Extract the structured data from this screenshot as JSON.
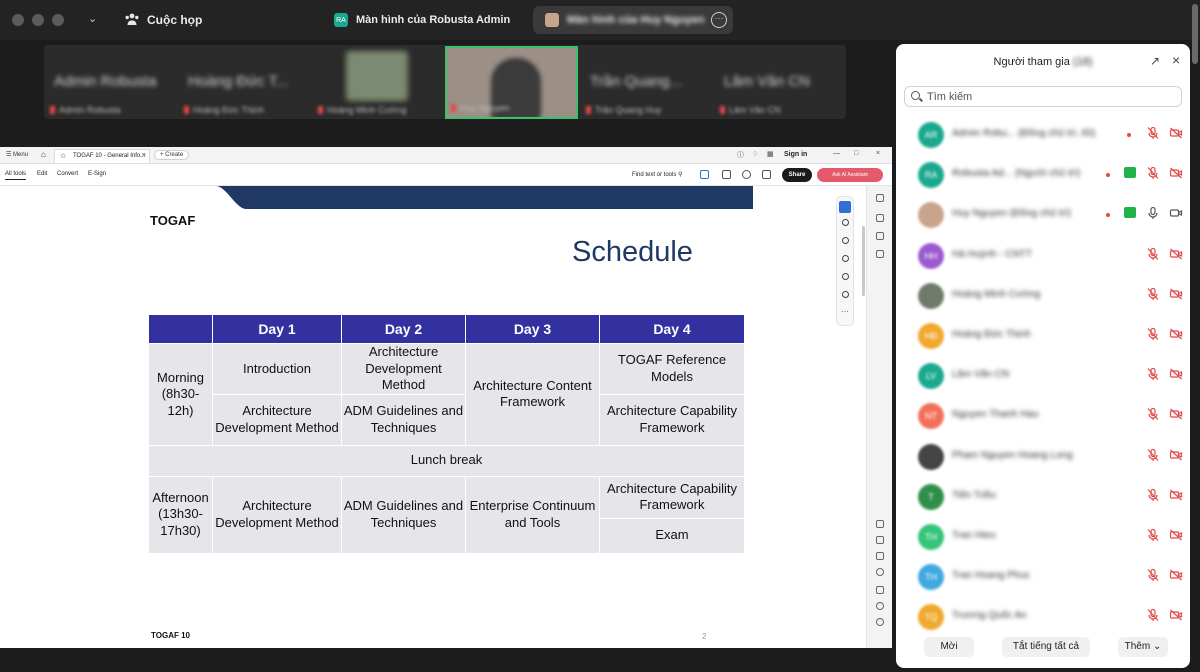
{
  "topbar": {
    "meeting_label": "Cuộc họp",
    "tab_share_own": {
      "avatar": "RA",
      "label": "Màn hình của Robusta Admin"
    },
    "tab_share_other": {
      "label": "Màn hình của Huy Nguyen"
    },
    "more_icon": "ellipsis-circle-icon"
  },
  "thumbnails": [
    {
      "name": "Admin Robusta",
      "sub": "Admin Robusta"
    },
    {
      "name": "Hoàng Đức T...",
      "sub": "Hoàng Đức Thịnh"
    },
    {
      "name": "",
      "sub": "Hoàng Minh Cường"
    },
    {
      "name": "",
      "sub": "Huy Nguyen"
    },
    {
      "name": "Trần Quang...",
      "sub": "Trần Quang Huy"
    },
    {
      "name": "Lâm Văn CN",
      "sub": "Lâm Văn CN"
    }
  ],
  "acrobat": {
    "menu": "Menu",
    "doc_tab": "TOGAF 10 - General Info...",
    "create": "Create",
    "sign_in": "Sign in",
    "tools": [
      "All tools",
      "Edit",
      "Convert",
      "E-Sign"
    ],
    "find": "Find text or tools",
    "share": "Share",
    "ask_ai": "Ask AI Assistant"
  },
  "slide": {
    "brand_head": "TOGAF",
    "title": "Schedule",
    "brand_foot": "TOGAF 10",
    "page": "2",
    "band_color": "#1f3864",
    "header_color": "#3330a0",
    "table": {
      "headers": [
        "",
        "Day 1",
        "Day 2",
        "Day 3",
        "Day 4"
      ],
      "morning_label": "Morning (8h30-12h)",
      "m_d1_a": "Introduction",
      "m_d1_b": "Architecture Development Method",
      "m_d2_a": "Architecture Development Method",
      "m_d2_b": "ADM Guidelines and Techniques",
      "m_d3": "Architecture Content Framework",
      "m_d4_a": "TOGAF Reference Models",
      "m_d4_b": "Architecture Capability Framework",
      "lunch": "Lunch break",
      "afternoon_label": "Afternoon (13h30-17h30)",
      "a_d1": "Architecture Development Method",
      "a_d2": "ADM Guidelines and Techniques",
      "a_d3": "Enterprise Continuum and Tools",
      "a_d4_a": "Architecture Capability Framework",
      "a_d4_b": "Exam"
    }
  },
  "panel": {
    "title": "Người tham gia",
    "count": "(18)",
    "search_placeholder": "Tìm kiếm",
    "participants": [
      {
        "initials": "AR",
        "name": "Admin Robu... (Đồng chủ trì, tôi)",
        "color": "#1aa98e",
        "status": "dot",
        "mic": "muted",
        "cam": "off"
      },
      {
        "initials": "RA",
        "name": "Robusta Ad... (Người chủ trì)",
        "color": "#1aa98e",
        "status": "green",
        "mic": "muted",
        "cam": "off"
      },
      {
        "initials": "",
        "name": "Huy Nguyen (Đồng chủ trì)",
        "color": "#c9a48c",
        "status": "green",
        "mic": "on",
        "cam": "on"
      },
      {
        "initials": "HH",
        "name": "Hà Huỳnh - CNTT",
        "color": "#9b59d0",
        "status": "",
        "mic": "muted",
        "cam": "off"
      },
      {
        "initials": "",
        "name": "Hoàng Minh Cường",
        "color": "#6f7b6a",
        "status": "",
        "mic": "muted",
        "cam": "off"
      },
      {
        "initials": "HĐ",
        "name": "Hoàng Đức Thịnh",
        "color": "#f0a92e",
        "status": "",
        "mic": "muted",
        "cam": "off"
      },
      {
        "initials": "LV",
        "name": "Lâm Văn CN",
        "color": "#1aa98e",
        "status": "",
        "mic": "muted",
        "cam": "off"
      },
      {
        "initials": "NT",
        "name": "Nguyen Thanh Hau",
        "color": "#f2705a",
        "status": "",
        "mic": "muted",
        "cam": "off"
      },
      {
        "initials": "",
        "name": "Pham Nguyen Hoang Long",
        "color": "#444444",
        "status": "",
        "mic": "muted",
        "cam": "off"
      },
      {
        "initials": "T",
        "name": "Tiến Triều",
        "color": "#2f8f4a",
        "status": "",
        "mic": "muted",
        "cam": "off"
      },
      {
        "initials": "TH",
        "name": "Tran Hieu",
        "color": "#35c47a",
        "status": "",
        "mic": "muted",
        "cam": "off"
      },
      {
        "initials": "TH",
        "name": "Tran Hoang Phuc",
        "color": "#3fa9e0",
        "status": "",
        "mic": "muted",
        "cam": "off"
      },
      {
        "initials": "TQ",
        "name": "Trương Quốc An",
        "color": "#f0a92e",
        "status": "",
        "mic": "muted",
        "cam": "off"
      }
    ],
    "footer": {
      "invite": "Mời",
      "mute_all": "Tắt tiếng tất cả",
      "more": "Thêm"
    }
  }
}
